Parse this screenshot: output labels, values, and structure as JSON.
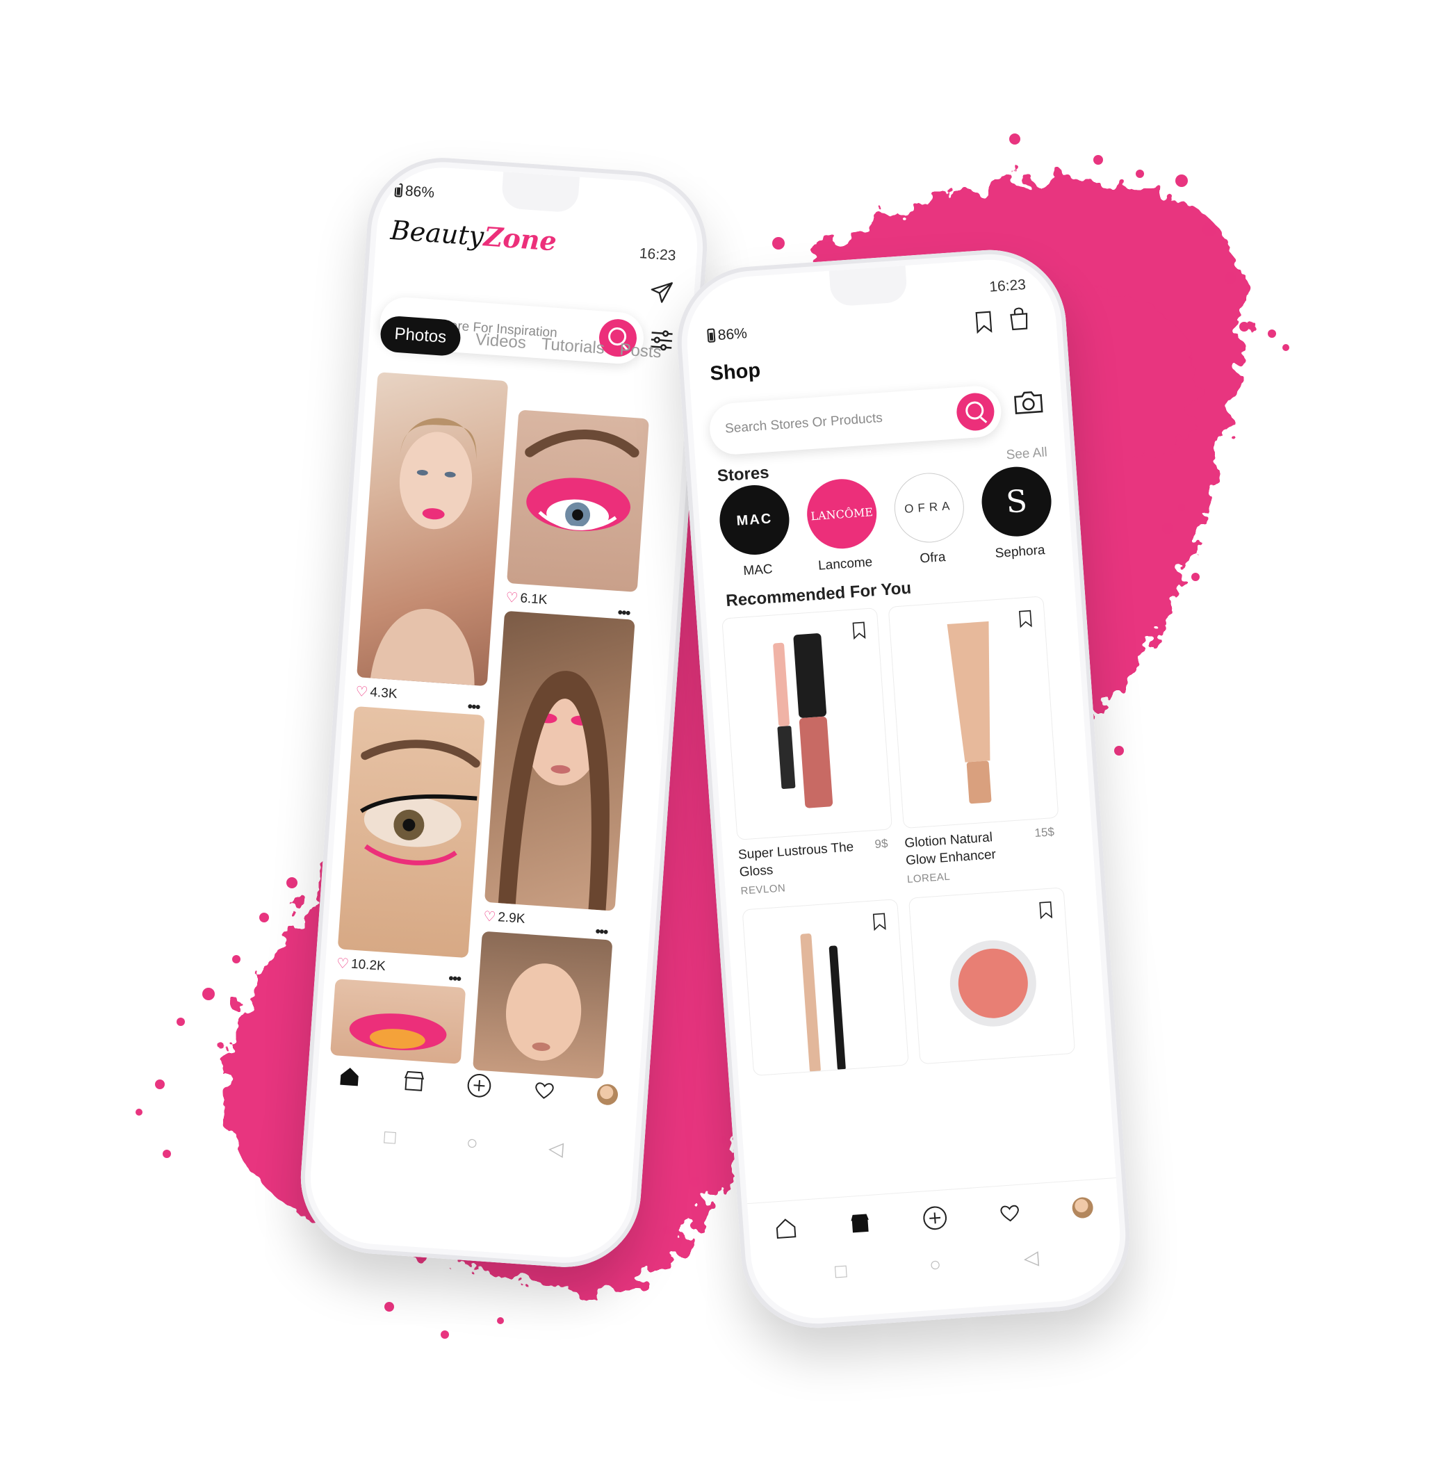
{
  "colors": {
    "accent": "#ec2f7a",
    "pigment": "#e8347f"
  },
  "feed_app": {
    "battery": "86%",
    "time": "16:23",
    "logo": {
      "script": "Beauty",
      "bold": "Zone"
    },
    "search": {
      "placeholder": "Search Here For Inspiration"
    },
    "tabs": [
      {
        "label": "Photos",
        "active": true
      },
      {
        "label": "Videos",
        "active": false
      },
      {
        "label": "Tutorials",
        "active": false
      },
      {
        "label": "Posts",
        "active": false
      }
    ],
    "posts": [
      {
        "likes": "4.3K"
      },
      {
        "likes": "6.1K"
      },
      {
        "likes": "10.2K"
      },
      {
        "likes": "2.9K"
      }
    ],
    "more_glyph": "•••",
    "nav_icons": [
      "home-icon",
      "store-icon",
      "add-icon",
      "heart-icon",
      "avatar"
    ]
  },
  "shop_app": {
    "battery": "86%",
    "time": "16:23",
    "title": "Shop",
    "search": {
      "placeholder": "Search Stores Or Products"
    },
    "see_all": "See All",
    "stores_title": "Stores",
    "stores": [
      {
        "name": "MAC",
        "logo_text": "MAC"
      },
      {
        "name": "Lancome",
        "logo_text": "LANCÔME"
      },
      {
        "name": "Ofra",
        "logo_text": "OFRA"
      },
      {
        "name": "Sephora",
        "logo_text": "S"
      }
    ],
    "recommended_title": "Recommended For You",
    "products": [
      {
        "name": "Super Lustrous The Gloss",
        "brand": "REVLON",
        "price": "9$"
      },
      {
        "name": "Glotion Natural Glow Enhancer",
        "brand": "LOREAL",
        "price": "15$"
      },
      {
        "name": "",
        "brand": "",
        "price": ""
      },
      {
        "name": "",
        "brand": "",
        "price": ""
      }
    ],
    "nav_icons": [
      "home-icon",
      "store-icon",
      "add-icon",
      "heart-icon",
      "avatar"
    ]
  }
}
